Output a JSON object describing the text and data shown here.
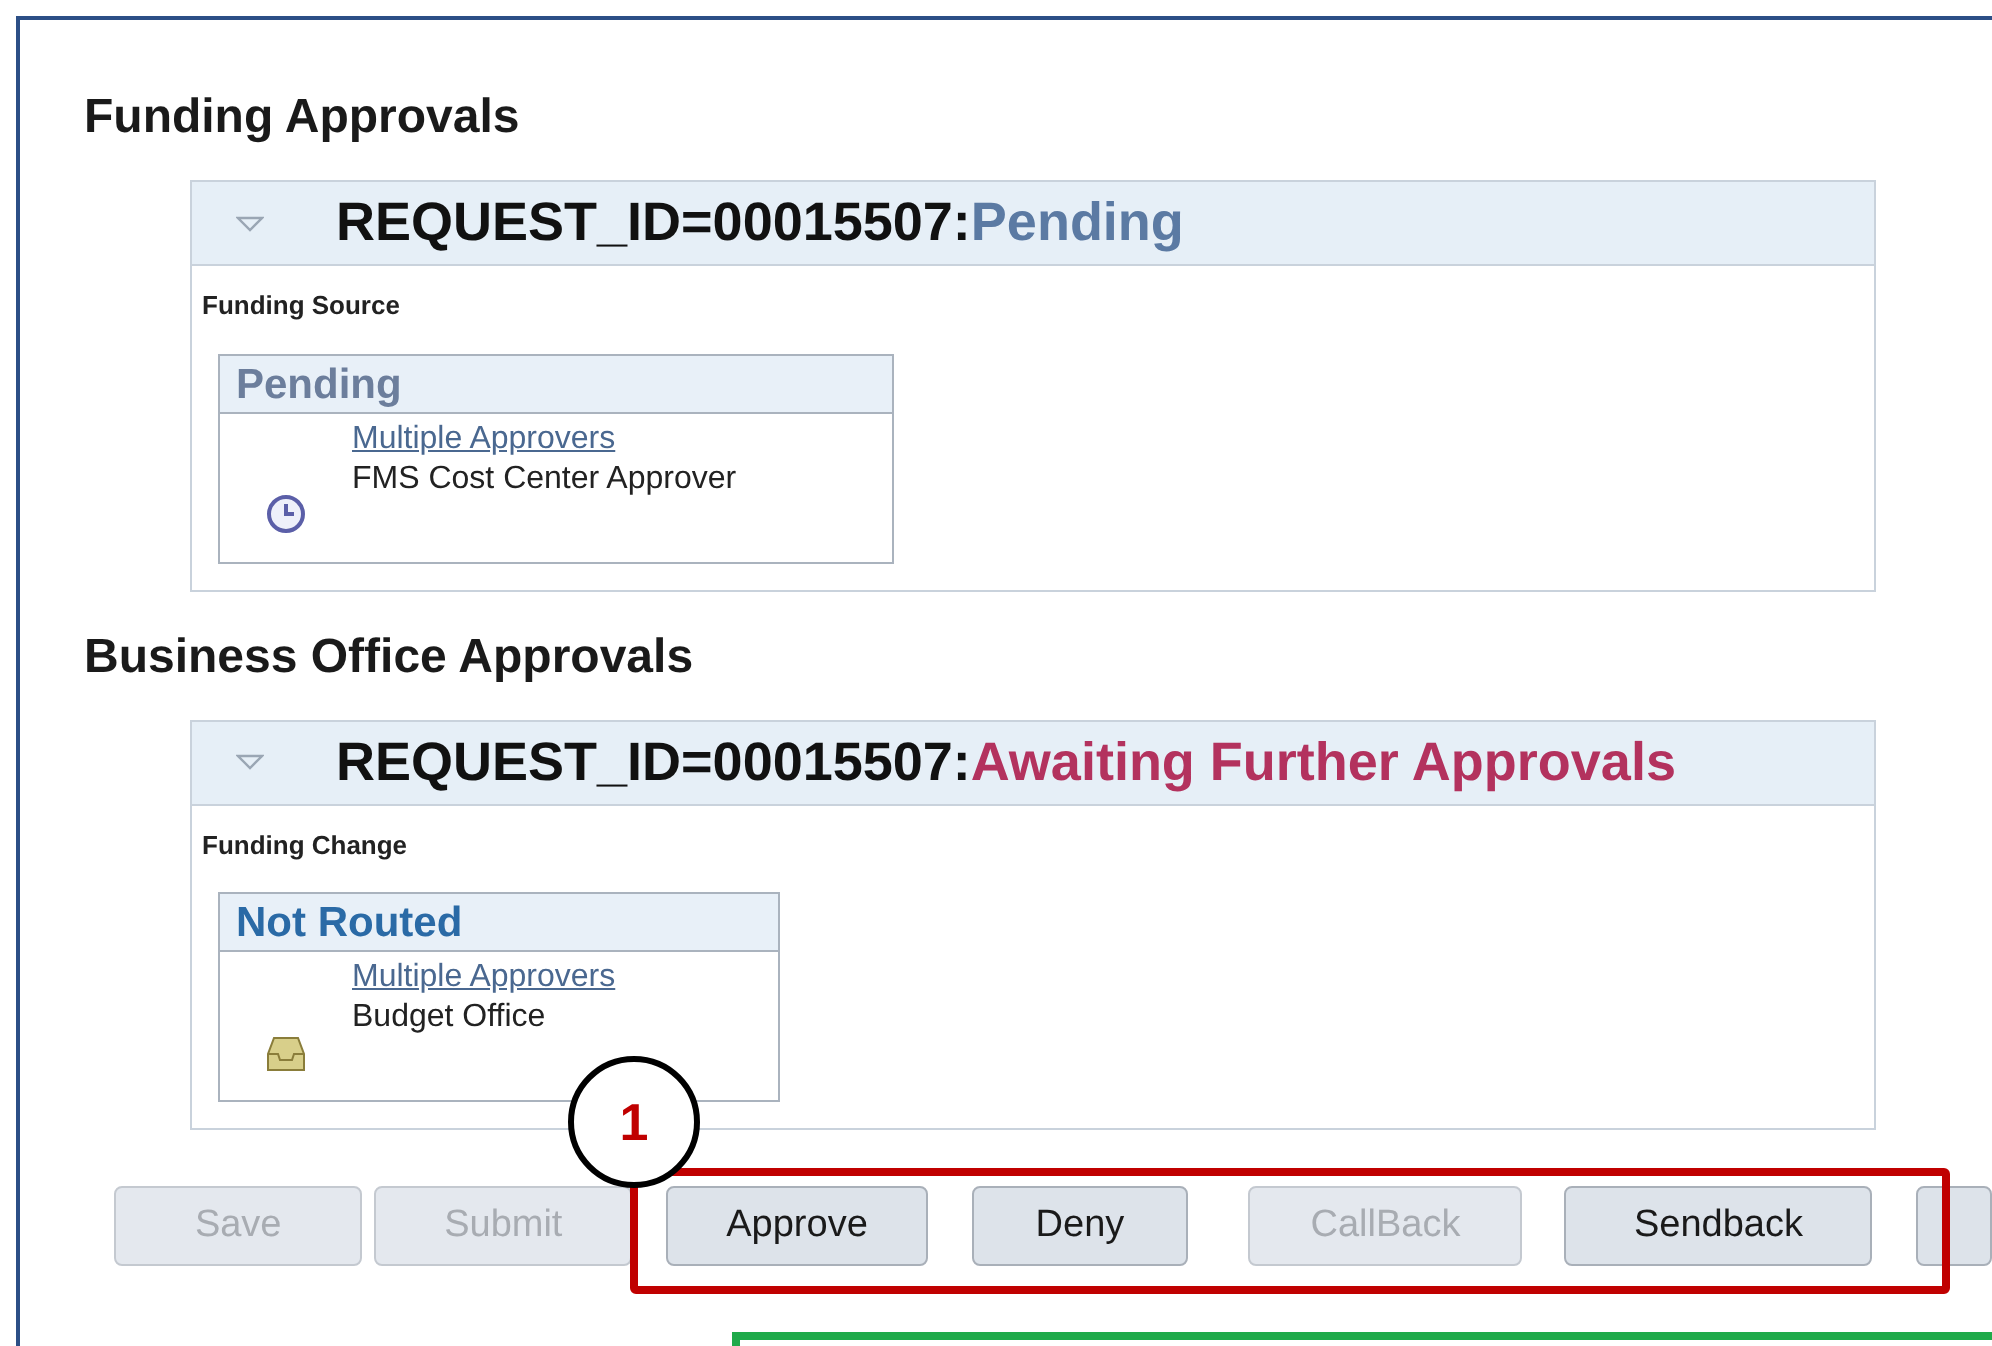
{
  "sections": [
    {
      "heading": "Funding Approvals",
      "request_id": "REQUEST_ID=00015507:",
      "status": {
        "text": "Pending",
        "color": "#5b7aa3"
      },
      "group_label": "Funding Source",
      "step": {
        "status": "Pending",
        "color": "#6c7e9c",
        "approver_link": "Multiple Approvers",
        "approver_role": "FMS Cost Center Approver",
        "kind": "clock"
      }
    },
    {
      "heading": "Business Office Approvals",
      "request_id": "REQUEST_ID=00015507:",
      "status": {
        "text": "Awaiting Further Approvals",
        "color": "#b3325e"
      },
      "group_label": "Funding Change",
      "step": {
        "status": "Not Routed",
        "color": "#2a6aa6",
        "approver_link": "Multiple Approvers",
        "approver_role": "Budget Office",
        "kind": "tray"
      }
    }
  ],
  "buttons": [
    {
      "label": "Save",
      "disabled": true
    },
    {
      "label": "Submit",
      "disabled": true
    },
    {
      "label": "Approve",
      "disabled": false
    },
    {
      "label": "Deny",
      "disabled": false
    },
    {
      "label": "CallBack",
      "disabled": true
    },
    {
      "label": "Sendback",
      "disabled": false
    }
  ],
  "callout": {
    "number": "1"
  }
}
